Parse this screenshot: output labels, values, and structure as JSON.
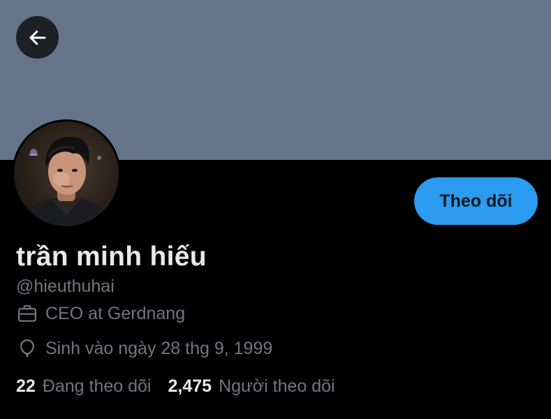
{
  "profile": {
    "display_name": "trần minh hiếu",
    "handle": "@hieuthuhai",
    "job": "CEO at Gerdnang",
    "birthday": "Sinh vào ngày 28 thg 9, 1999",
    "follow_label": "Theo dõi",
    "following_count": "22",
    "following_label": "Đang theo dõi",
    "followers_count": "2,475",
    "followers_label": "Người theo dõi"
  },
  "icons": {
    "back": "arrow-left-icon",
    "job": "briefcase-icon",
    "birthday": "balloon-icon"
  },
  "colors": {
    "banner": "#66748a",
    "accent": "#2a9bef",
    "background": "#000000",
    "primary_text": "#e7e9ea",
    "secondary_text": "#71767b"
  }
}
